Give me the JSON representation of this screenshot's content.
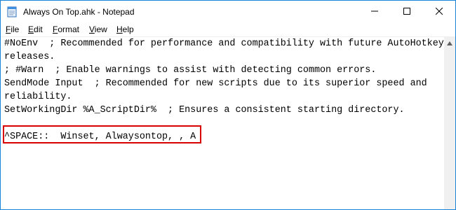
{
  "window": {
    "title": "Always On Top.ahk - Notepad"
  },
  "menu": {
    "file_first": "F",
    "file_rest": "ile",
    "edit_first": "E",
    "edit_rest": "dit",
    "format_first": "F",
    "format_pre": "",
    "format_rest": "ormat",
    "view_first": "V",
    "view_rest": "iew",
    "help_first": "H",
    "help_rest": "elp"
  },
  "editor": {
    "lines": [
      "#NoEnv  ; Recommended for performance and compatibility with future AutoHotkey",
      "releases.",
      "; #Warn  ; Enable warnings to assist with detecting common errors.",
      "SendMode Input  ; Recommended for new scripts due to its superior speed and",
      "reliability.",
      "SetWorkingDir %A_ScriptDir%  ; Ensures a consistent starting directory.",
      "",
      "^SPACE::  Winset, Alwaysontop, , A"
    ]
  },
  "colors": {
    "highlight_border": "#d60000",
    "window_border": "#1883d7"
  },
  "icons": [
    "notepad-icon",
    "minimize-icon",
    "maximize-icon",
    "close-icon",
    "scroll-up-arrow-icon"
  ]
}
